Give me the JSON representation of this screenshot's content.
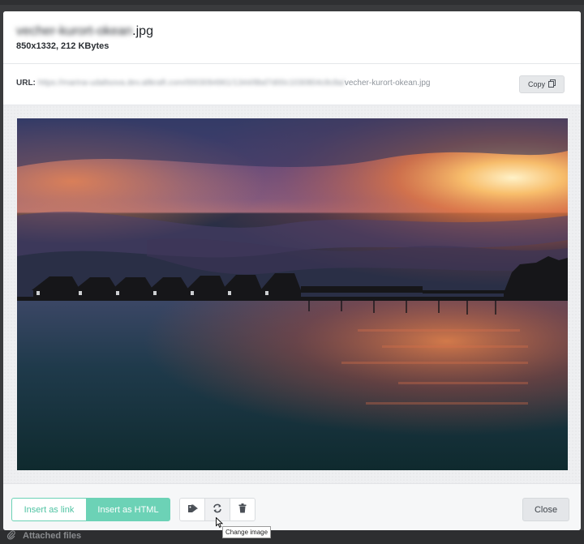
{
  "modal": {
    "file_name_base": "vecher-kurort-okean",
    "file_name_ext": ".jpg",
    "file_meta": "850x1332, 212 KBytes"
  },
  "url_bar": {
    "label": "URL:",
    "url_prefix": "https://marina-udaltsova.dev.altkraft.com/0003094961/1344/8bd7d00c1030804c8c8a/",
    "url_suffix": "vecher-kurort-okean.jpg",
    "copy_label": "Copy",
    "copy_icon": "copy-icon"
  },
  "footer": {
    "insert_link_label": "Insert as link",
    "insert_html_label": "Insert as HTML",
    "tag_icon": "tag-icon",
    "change_icon": "refresh-icon",
    "delete_icon": "trash-icon",
    "close_label": "Close",
    "tooltip": "Change image"
  },
  "background": {
    "attached_files_label": "Attached files",
    "attached_icon": "paperclip-icon"
  },
  "colors": {
    "accent": "#6cd2b6",
    "accent_text": "#4fc3a3"
  }
}
